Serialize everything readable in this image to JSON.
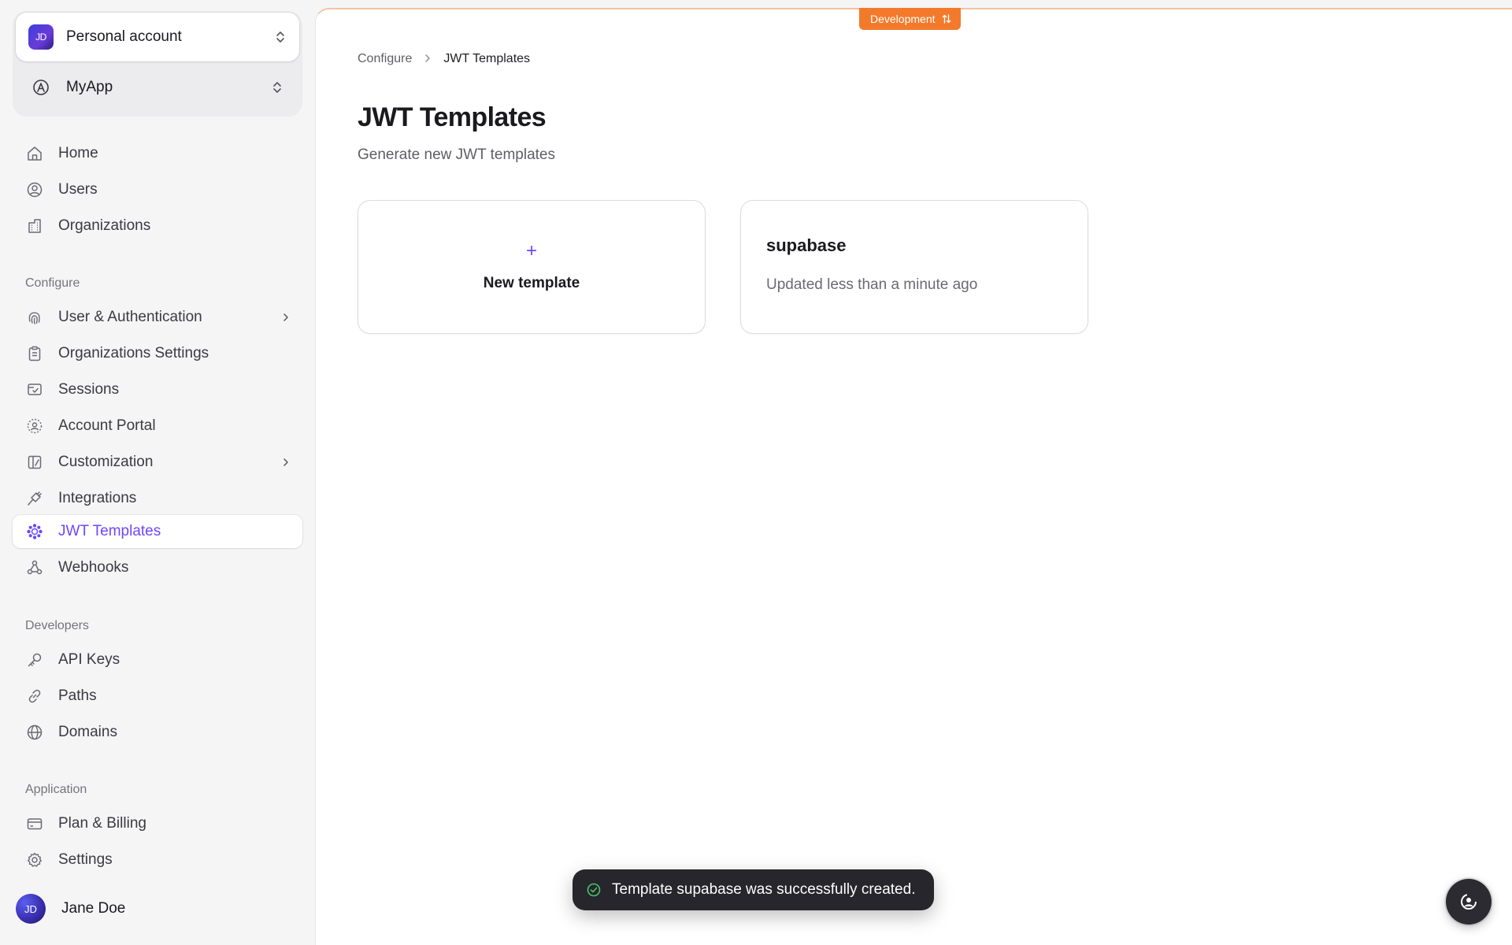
{
  "sidebar": {
    "account": {
      "initials": "JD",
      "name": "Personal account",
      "icon": "chevron-up-down-icon"
    },
    "app": {
      "name": "MyApp",
      "icon": "app-logo-icon"
    },
    "primary": [
      {
        "label": "Home",
        "icon": "home-icon"
      },
      {
        "label": "Users",
        "icon": "user-circle-icon"
      },
      {
        "label": "Organizations",
        "icon": "building-icon"
      }
    ],
    "configure_title": "Configure",
    "configure": [
      {
        "label": "User & Authentication",
        "icon": "fingerprint-icon",
        "chevron": true
      },
      {
        "label": "Organizations Settings",
        "icon": "clipboard-icon"
      },
      {
        "label": "Sessions",
        "icon": "session-icon"
      },
      {
        "label": "Account Portal",
        "icon": "portal-icon"
      },
      {
        "label": "Customization",
        "icon": "customize-icon",
        "chevron": true
      },
      {
        "label": "Integrations",
        "icon": "plug-icon"
      },
      {
        "label": "JWT Templates",
        "icon": "jwt-icon",
        "active": true
      },
      {
        "label": "Webhooks",
        "icon": "webhook-icon"
      }
    ],
    "developers_title": "Developers",
    "developers": [
      {
        "label": "API Keys",
        "icon": "key-icon"
      },
      {
        "label": "Paths",
        "icon": "link-icon"
      },
      {
        "label": "Domains",
        "icon": "globe-icon"
      }
    ],
    "application_title": "Application",
    "application": [
      {
        "label": "Plan & Billing",
        "icon": "card-icon"
      },
      {
        "label": "Settings",
        "icon": "gear-icon"
      }
    ],
    "user": {
      "initials": "JD",
      "name": "Jane Doe"
    }
  },
  "header": {
    "env_badge": "Development",
    "breadcrumb": {
      "parent": "Configure",
      "current": "JWT Templates"
    }
  },
  "main": {
    "title": "JWT Templates",
    "subtitle": "Generate new JWT templates",
    "new_card": {
      "icon": "+",
      "label": "New template"
    },
    "templates": [
      {
        "name": "supabase",
        "updated": "Updated less than a minute ago"
      }
    ]
  },
  "toast": {
    "message": "Template supabase was successfully created."
  },
  "colors": {
    "accent": "#6c47ff",
    "env": "#f47a2b",
    "toast_bg": "#26262c",
    "success": "#4cc36a"
  }
}
